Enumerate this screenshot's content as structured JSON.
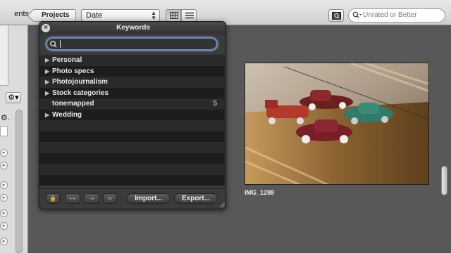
{
  "toolbar": {
    "left_tab_label": "ents",
    "projects_label": "Projects",
    "sort_value": "Date",
    "filter_placeholder": "Unrated or Better"
  },
  "keywords_hud": {
    "title": "Keywords",
    "search_value": "",
    "items": [
      {
        "label": "Personal",
        "expandable": true,
        "count": ""
      },
      {
        "label": "Photo specs",
        "expandable": true,
        "count": ""
      },
      {
        "label": "Photojournalism",
        "expandable": true,
        "count": ""
      },
      {
        "label": "Stock categories",
        "expandable": true,
        "count": ""
      },
      {
        "label": "tonemapped",
        "expandable": false,
        "count": "5"
      },
      {
        "label": "Wedding",
        "expandable": true,
        "count": ""
      }
    ],
    "import_label": "Import...",
    "export_label": "Export..."
  },
  "photo": {
    "caption": "IMG_1288"
  },
  "icons": [
    "close-icon",
    "search-icon",
    "grid-view-icon",
    "list-view-icon",
    "browser-icon",
    "gear-icon",
    "lock-icon",
    "add-keyword-icon",
    "remove-keyword-icon",
    "tag-icon",
    "resize-grip-icon"
  ]
}
